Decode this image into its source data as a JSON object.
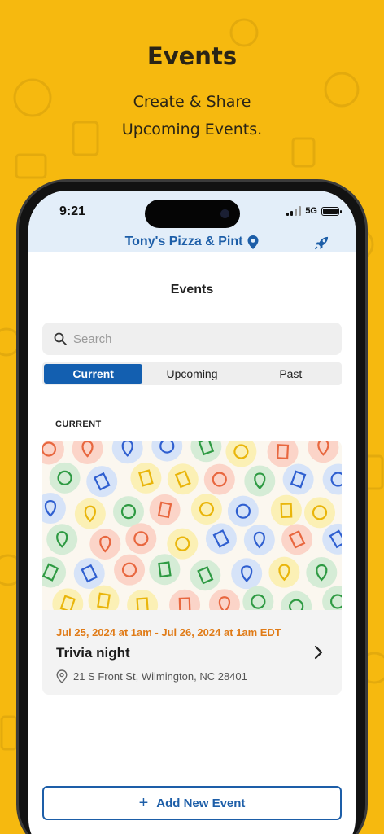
{
  "promo": {
    "title": "Events",
    "subtitle_line1": "Create & Share",
    "subtitle_line2": "Upcoming Events."
  },
  "status_bar": {
    "time": "9:21",
    "network": "5G"
  },
  "header": {
    "venue_name": "Tony's Pizza & Pint",
    "location_icon": "map-pin-icon",
    "action_icon": "rocket-icon"
  },
  "page": {
    "title": "Events"
  },
  "search": {
    "placeholder": "Search"
  },
  "tabs": [
    {
      "label": "Current",
      "active": true
    },
    {
      "label": "Upcoming",
      "active": false
    },
    {
      "label": "Past",
      "active": false
    }
  ],
  "section": {
    "label": "CURRENT"
  },
  "events": [
    {
      "date_range": "Jul 25, 2024 at 1am - Jul 26, 2024 at 1am EDT",
      "title": "Trivia night",
      "address": "21 S Front St, Wilmington, NC 28401"
    }
  ],
  "add_button": {
    "label": "Add New Event"
  },
  "colors": {
    "background": "#f6b90f",
    "primary": "#135fb0",
    "accent_date": "#e07b17",
    "header_tint": "#e3eef9"
  }
}
